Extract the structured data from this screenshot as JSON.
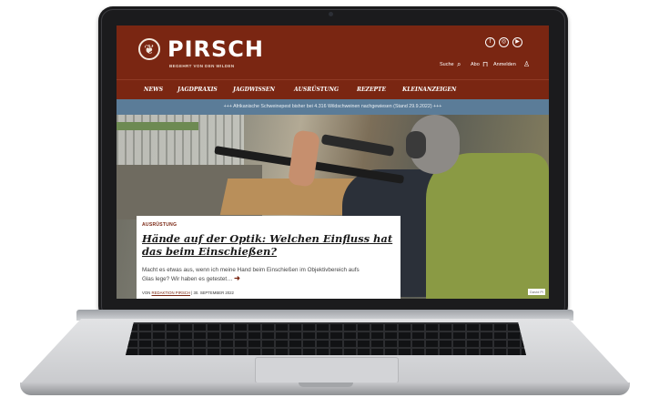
{
  "site": {
    "brand": "PIRSCH",
    "tagline": "BEGEHRT VON DEN WILDEN",
    "social": [
      "f",
      "◎",
      "▶"
    ],
    "search_label": "Suche",
    "abo_label": "Abo",
    "login_label": "Anmelden"
  },
  "nav": {
    "items": [
      "NEWS",
      "JAGDPRAXIS",
      "JAGDWISSEN",
      "AUSRÜSTUNG",
      "REZEPTE",
      "KLEINANZEIGEN"
    ]
  },
  "ticker": {
    "text": "+++ Afrikanische Schweinepest bisher bei 4.316 Wildschweinen nachgewiesen (Stand 29.9.2022) +++"
  },
  "article": {
    "kicker": "AUSRÜSTUNG",
    "title": "Hände auf der Optik: Welchen Einfluss hat das beim Einschießen?",
    "teaser": "Macht es etwas aus, wenn ich meine Hand beim Einschießen im Objektivbereich aufs Glas lege? Wir haben es getestet…",
    "arrow": "➜",
    "meta_prefix": "VON",
    "author": "REDAKTION PIRSCH",
    "date": "| 30. SEPTEMBER 2022",
    "photo_credit": "David Pi"
  },
  "icons": {
    "logo": "deer-antler-icon",
    "search": "search-icon",
    "cart": "shopping-bag-icon",
    "user": "user-icon"
  },
  "colors": {
    "brand_red": "#7a2612",
    "ticker_blue": "#5b7c98"
  }
}
